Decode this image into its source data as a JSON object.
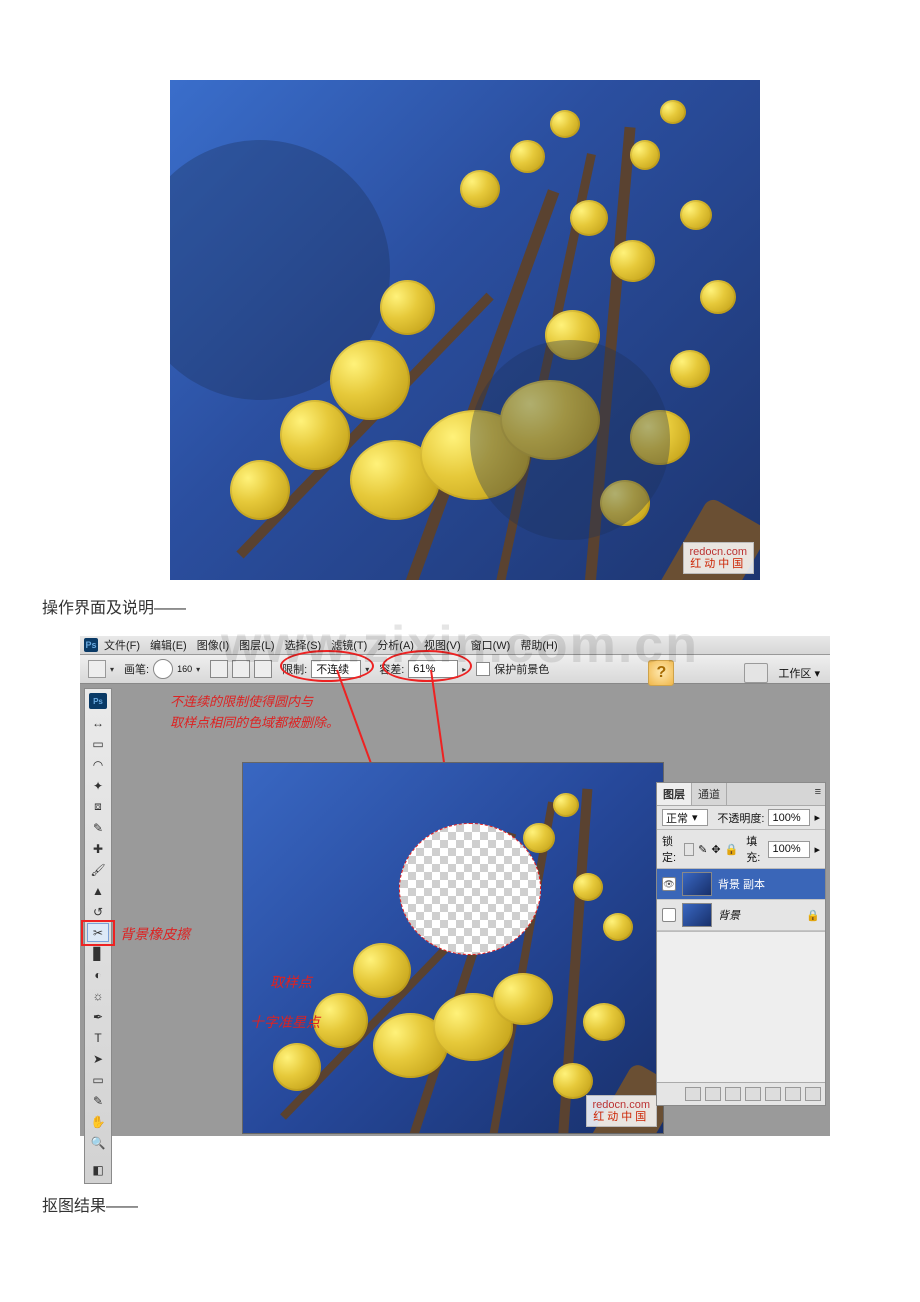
{
  "caption_interface": "操作界面及说明——",
  "caption_result": "抠图结果——",
  "watermark": "www.zixin.com.cn",
  "site_watermark": {
    "line1": "redocn.com",
    "line2": "红动中国"
  },
  "ps": {
    "menu": {
      "file": "文件(F)",
      "edit": "编辑(E)",
      "image": "图像(I)",
      "layer": "图层(L)",
      "select": "选择(S)",
      "filter": "滤镜(T)",
      "analysis": "分析(A)",
      "view": "视图(V)",
      "window": "窗口(W)",
      "help": "帮助(H)"
    },
    "options": {
      "brush_label": "画笔:",
      "brush_size": "160",
      "limits_label": "限制:",
      "limits_value": "不连续",
      "tolerance_label": "容差:",
      "tolerance_value": "61%",
      "protect_label": "保护前景色",
      "workspace_label": "工作区 ▾"
    },
    "tools_label": "背景橡皮擦",
    "red_tip_line1": "不连续的限制使得圆内与",
    "red_tip_line2": "取样点相同的色域都被删除。",
    "canvas_ann_sample": "取样点",
    "canvas_ann_cursor": "十字准星点",
    "layers_panel": {
      "tab_layers": "图层",
      "tab_channels": "通道",
      "blend_mode": "正常",
      "opacity_label": "不透明度:",
      "opacity_value": "100%",
      "lock_label": "锁定:",
      "fill_label": " 填充:",
      "fill_value": "100%",
      "layer_copy": "背景 副本",
      "layer_bg": "背景"
    }
  }
}
